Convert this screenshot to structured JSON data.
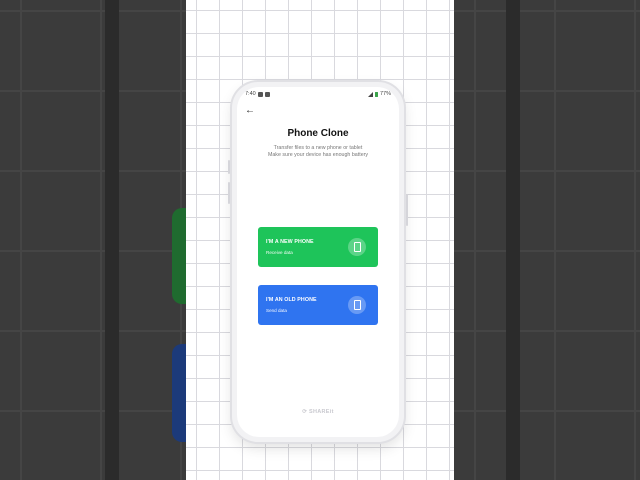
{
  "status_bar": {
    "time": "7:40",
    "battery": "77%"
  },
  "screen": {
    "title": "Phone Clone",
    "subtitle_line1": "Transfer files to a new phone or tablet",
    "subtitle_line2": "Make sure your device has enough battery"
  },
  "options": [
    {
      "title": "I'M A NEW PHONE",
      "subtitle": "Receive data",
      "color": "#1ec45a",
      "icon": "phone-receive-icon"
    },
    {
      "title": "I'M AN OLD PHONE",
      "subtitle": "Send data",
      "color": "#2f74f0",
      "icon": "phone-send-icon"
    }
  ],
  "footer": {
    "brand": "SHAREit",
    "tagline": ""
  },
  "colors": {
    "green": "#1ec45a",
    "blue": "#2f74f0",
    "grid": "#d9d9de"
  }
}
